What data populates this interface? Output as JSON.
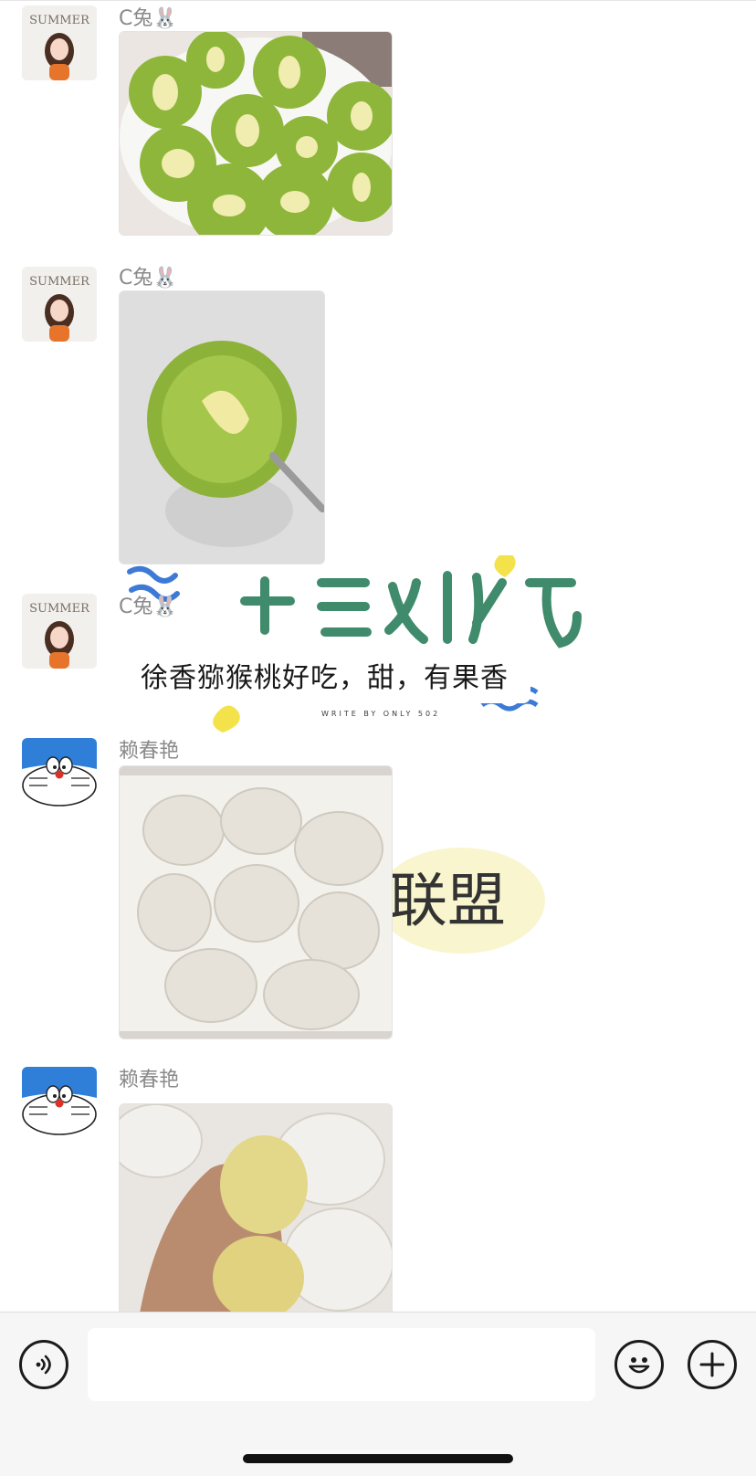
{
  "messages": [
    {
      "type": "image",
      "sender": "C兔🐰",
      "avatar": "summer-girl-avatar",
      "image": "kiwi-slices-on-plate-photo"
    },
    {
      "type": "image",
      "sender": "C兔🐰",
      "avatar": "summer-girl-avatar",
      "image": "kiwi-slice-on-fork-photo"
    },
    {
      "type": "text",
      "sender": "C兔🐰",
      "avatar": "summer-girl-avatar",
      "text": "徐香猕猴桃好吃，甜，有果香"
    },
    {
      "type": "image",
      "sender": "赖春艳",
      "avatar": "doraemon-avatar",
      "image": "fruit-box-foam-nets-photo"
    },
    {
      "type": "image",
      "sender": "赖春艳",
      "avatar": "doraemon-avatar",
      "image": "hand-holding-fruit-photo"
    }
  ],
  "avatar_text": {
    "summer": "SUMMER"
  },
  "sticker_text": {
    "bottom": "联盟",
    "small": "WRITE BY ONLY 502"
  },
  "input_bar": {
    "placeholder": "",
    "icons": [
      "voice-icon",
      "emoji-icon",
      "plus-icon"
    ]
  },
  "colors": {
    "kiwi_green": "#7fae2e",
    "kiwi_core": "#f0e9a6",
    "sticker_yellow": "#f3e24a",
    "sticker_blue": "#3d7ad6",
    "sticker_green": "#3f8b6c",
    "doraemon_blue": "#2f7fd8"
  }
}
